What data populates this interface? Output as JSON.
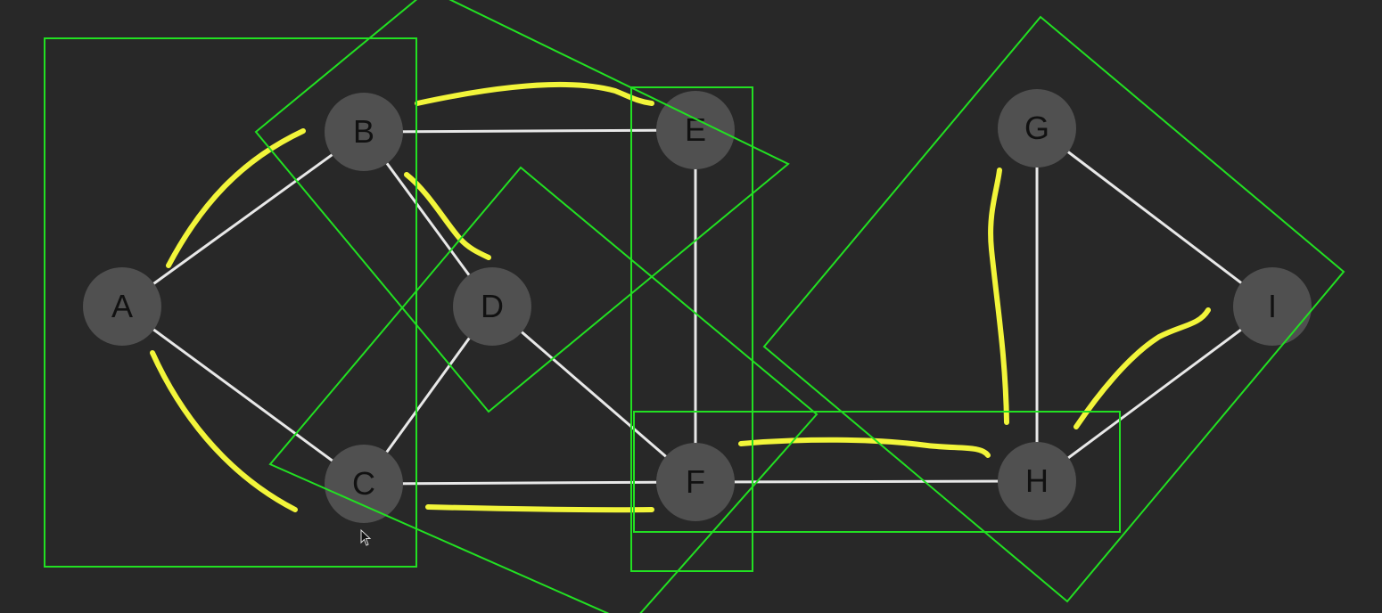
{
  "colors": {
    "background": "#282828",
    "node_fill": "#505050",
    "node_label": "#111111",
    "edge": "#e8e8e8",
    "highlight_stroke": "#f2f53a",
    "selection_box": "#22e022"
  },
  "graph": {
    "nodes": [
      {
        "id": "A",
        "label": "A"
      },
      {
        "id": "B",
        "label": "B"
      },
      {
        "id": "C",
        "label": "C"
      },
      {
        "id": "D",
        "label": "D"
      },
      {
        "id": "E",
        "label": "E"
      },
      {
        "id": "F",
        "label": "F"
      },
      {
        "id": "G",
        "label": "G"
      },
      {
        "id": "H",
        "label": "H"
      },
      {
        "id": "I",
        "label": "I"
      }
    ],
    "edges": [
      {
        "from": "A",
        "to": "B"
      },
      {
        "from": "A",
        "to": "C"
      },
      {
        "from": "B",
        "to": "E"
      },
      {
        "from": "B",
        "to": "D"
      },
      {
        "from": "C",
        "to": "D"
      },
      {
        "from": "C",
        "to": "F"
      },
      {
        "from": "D",
        "to": "F"
      },
      {
        "from": "E",
        "to": "F"
      },
      {
        "from": "F",
        "to": "H"
      },
      {
        "from": "G",
        "to": "H"
      },
      {
        "from": "G",
        "to": "I"
      },
      {
        "from": "H",
        "to": "I"
      }
    ],
    "highlighted_edges": [
      {
        "from": "A",
        "to": "B"
      },
      {
        "from": "A",
        "to": "C"
      },
      {
        "from": "B",
        "to": "E"
      },
      {
        "from": "B",
        "to": "D"
      },
      {
        "from": "C",
        "to": "F"
      },
      {
        "from": "F",
        "to": "H"
      },
      {
        "from": "G",
        "to": "H"
      },
      {
        "from": "H",
        "to": "I"
      }
    ]
  }
}
